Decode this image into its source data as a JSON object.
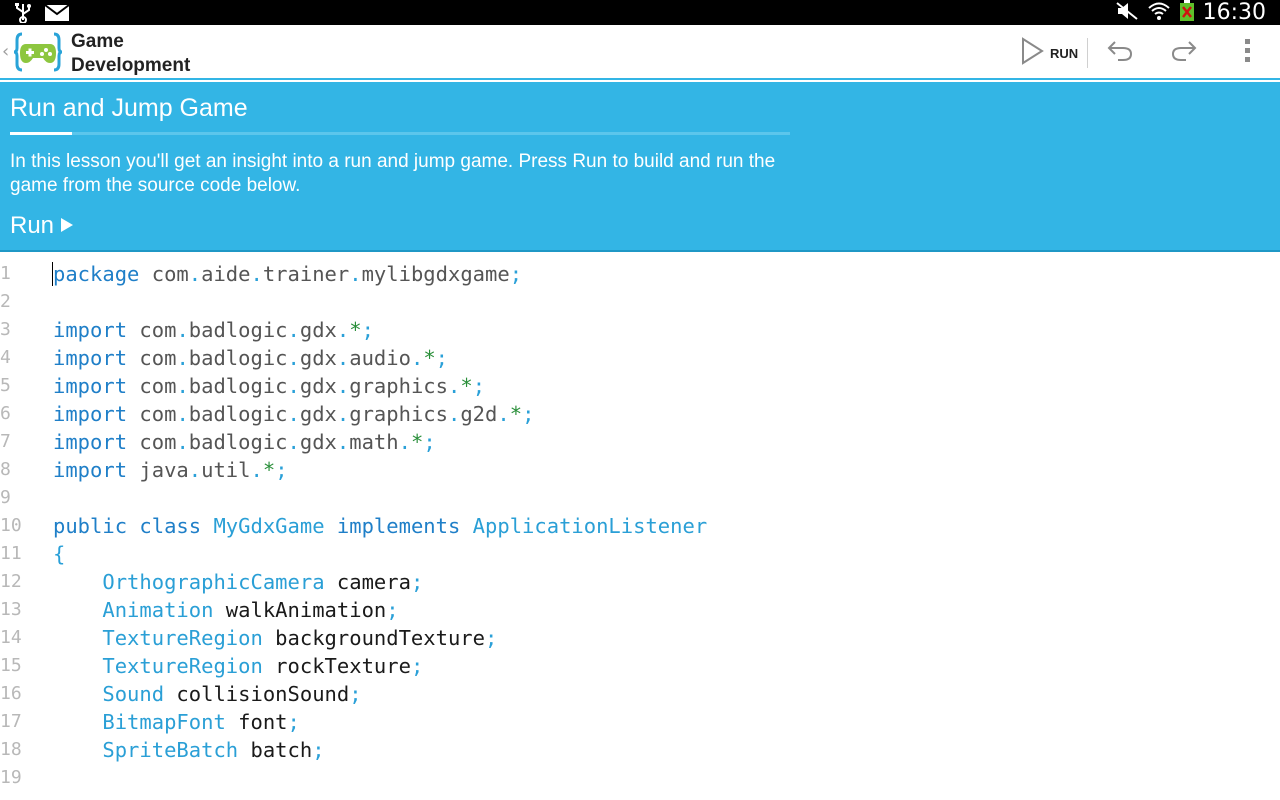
{
  "status_bar": {
    "time": "16:30",
    "icons": [
      "usb-icon",
      "email-icon",
      "mute-icon",
      "wifi-icon",
      "battery-icon"
    ]
  },
  "action_bar": {
    "back_glyph": "‹",
    "app_title_line1": "Game",
    "app_title_line2": "Development",
    "run_label": "RUN",
    "icons": [
      "run-icon",
      "undo-icon",
      "redo-icon",
      "overflow-menu-icon"
    ]
  },
  "lesson": {
    "title": "Run and Jump Game",
    "progress_fraction": 0.08,
    "text": "In this lesson you'll get an insight into a run and jump game. Press Run to build and run the game from the source code below.",
    "run_label": "Run"
  },
  "colors": {
    "accent": "#33b5e5",
    "keyword": "#1f7fc8",
    "type": "#2a9fd6"
  },
  "editor": {
    "lines": [
      {
        "n": "1",
        "tokens": [
          [
            "kw",
            "package"
          ],
          [
            "pk",
            " com"
          ],
          [
            "pu",
            "."
          ],
          [
            "pk",
            "aide"
          ],
          [
            "pu",
            "."
          ],
          [
            "pk",
            "trainer"
          ],
          [
            "pu",
            "."
          ],
          [
            "pk",
            "mylibgdxgame"
          ],
          [
            "pu",
            ";"
          ]
        ]
      },
      {
        "n": "2",
        "tokens": []
      },
      {
        "n": "3",
        "tokens": [
          [
            "kw",
            "import"
          ],
          [
            "pk",
            " com"
          ],
          [
            "pu",
            "."
          ],
          [
            "pk",
            "badlogic"
          ],
          [
            "pu",
            "."
          ],
          [
            "pk",
            "gdx"
          ],
          [
            "pu",
            "."
          ],
          [
            "star",
            "*"
          ],
          [
            "pu",
            ";"
          ]
        ]
      },
      {
        "n": "4",
        "tokens": [
          [
            "kw",
            "import"
          ],
          [
            "pk",
            " com"
          ],
          [
            "pu",
            "."
          ],
          [
            "pk",
            "badlogic"
          ],
          [
            "pu",
            "."
          ],
          [
            "pk",
            "gdx"
          ],
          [
            "pu",
            "."
          ],
          [
            "pk",
            "audio"
          ],
          [
            "pu",
            "."
          ],
          [
            "star",
            "*"
          ],
          [
            "pu",
            ";"
          ]
        ]
      },
      {
        "n": "5",
        "tokens": [
          [
            "kw",
            "import"
          ],
          [
            "pk",
            " com"
          ],
          [
            "pu",
            "."
          ],
          [
            "pk",
            "badlogic"
          ],
          [
            "pu",
            "."
          ],
          [
            "pk",
            "gdx"
          ],
          [
            "pu",
            "."
          ],
          [
            "pk",
            "graphics"
          ],
          [
            "pu",
            "."
          ],
          [
            "star",
            "*"
          ],
          [
            "pu",
            ";"
          ]
        ]
      },
      {
        "n": "6",
        "tokens": [
          [
            "kw",
            "import"
          ],
          [
            "pk",
            " com"
          ],
          [
            "pu",
            "."
          ],
          [
            "pk",
            "badlogic"
          ],
          [
            "pu",
            "."
          ],
          [
            "pk",
            "gdx"
          ],
          [
            "pu",
            "."
          ],
          [
            "pk",
            "graphics"
          ],
          [
            "pu",
            "."
          ],
          [
            "pk",
            "g2d"
          ],
          [
            "pu",
            "."
          ],
          [
            "star",
            "*"
          ],
          [
            "pu",
            ";"
          ]
        ]
      },
      {
        "n": "7",
        "tokens": [
          [
            "kw",
            "import"
          ],
          [
            "pk",
            " com"
          ],
          [
            "pu",
            "."
          ],
          [
            "pk",
            "badlogic"
          ],
          [
            "pu",
            "."
          ],
          [
            "pk",
            "gdx"
          ],
          [
            "pu",
            "."
          ],
          [
            "pk",
            "math"
          ],
          [
            "pu",
            "."
          ],
          [
            "star",
            "*"
          ],
          [
            "pu",
            ";"
          ]
        ]
      },
      {
        "n": "8",
        "tokens": [
          [
            "kw",
            "import"
          ],
          [
            "pk",
            " java"
          ],
          [
            "pu",
            "."
          ],
          [
            "pk",
            "util"
          ],
          [
            "pu",
            "."
          ],
          [
            "star",
            "*"
          ],
          [
            "pu",
            ";"
          ]
        ]
      },
      {
        "n": "9",
        "tokens": []
      },
      {
        "n": "10",
        "tokens": [
          [
            "kw",
            "public"
          ],
          [
            "pk",
            " "
          ],
          [
            "kw",
            "class"
          ],
          [
            "pk",
            " "
          ],
          [
            "ty",
            "MyGdxGame"
          ],
          [
            "pk",
            " "
          ],
          [
            "kw",
            "implements"
          ],
          [
            "pk",
            " "
          ],
          [
            "ty",
            "ApplicationListener"
          ]
        ]
      },
      {
        "n": "11",
        "tokens": [
          [
            "pu",
            "{"
          ]
        ]
      },
      {
        "n": "12",
        "tokens": [
          [
            "pk",
            "    "
          ],
          [
            "ty",
            "OrthographicCamera"
          ],
          [
            "id",
            " camera"
          ],
          [
            "pu",
            ";"
          ]
        ]
      },
      {
        "n": "13",
        "tokens": [
          [
            "pk",
            "    "
          ],
          [
            "ty",
            "Animation"
          ],
          [
            "id",
            " walkAnimation"
          ],
          [
            "pu",
            ";"
          ]
        ]
      },
      {
        "n": "14",
        "tokens": [
          [
            "pk",
            "    "
          ],
          [
            "ty",
            "TextureRegion"
          ],
          [
            "id",
            " backgroundTexture"
          ],
          [
            "pu",
            ";"
          ]
        ]
      },
      {
        "n": "15",
        "tokens": [
          [
            "pk",
            "    "
          ],
          [
            "ty",
            "TextureRegion"
          ],
          [
            "id",
            " rockTexture"
          ],
          [
            "pu",
            ";"
          ]
        ]
      },
      {
        "n": "16",
        "tokens": [
          [
            "pk",
            "    "
          ],
          [
            "ty",
            "Sound"
          ],
          [
            "id",
            " collisionSound"
          ],
          [
            "pu",
            ";"
          ]
        ]
      },
      {
        "n": "17",
        "tokens": [
          [
            "pk",
            "    "
          ],
          [
            "ty",
            "BitmapFont"
          ],
          [
            "id",
            " font"
          ],
          [
            "pu",
            ";"
          ]
        ]
      },
      {
        "n": "18",
        "tokens": [
          [
            "pk",
            "    "
          ],
          [
            "ty",
            "SpriteBatch"
          ],
          [
            "id",
            " batch"
          ],
          [
            "pu",
            ";"
          ]
        ]
      },
      {
        "n": "19",
        "tokens": []
      }
    ]
  }
}
